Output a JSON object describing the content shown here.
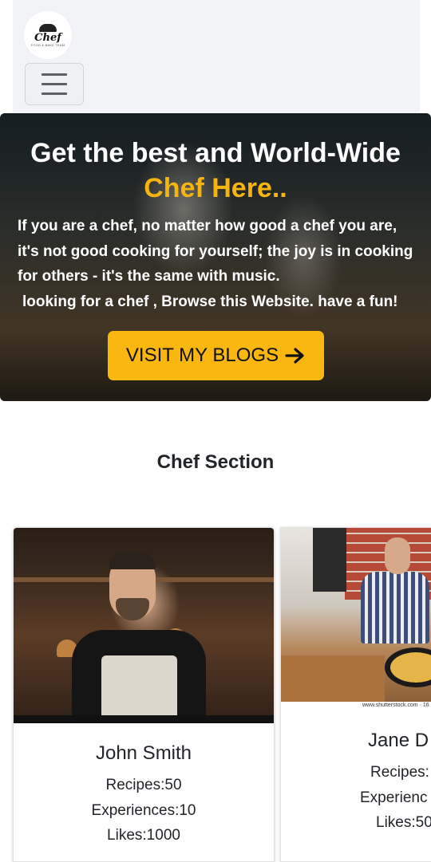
{
  "navbar": {
    "logo_text": "Chef",
    "logo_tagline": "FOOD & BAKE TEAM",
    "menu_button": "hamburger-icon"
  },
  "hero": {
    "title": "Get the best and World-Wide",
    "title_accent": "Chef Here..",
    "text_line1": "If you are a chef, no matter how good a chef you are, it's not good cooking for yourself; the joy is in cooking for others - it's the same with music.",
    "text_line2": "looking for a chef , Browse this Website. have a fun!",
    "button_label": "VISIT MY BLOGS",
    "button_icon": "arrow-right-icon",
    "accent_color": "#f9b710"
  },
  "chef_section": {
    "title": "Chef Section",
    "chefs": [
      {
        "name": "John Smith",
        "recipes": "Recipes:50",
        "experiences": "Experiences:10",
        "likes": "Likes:1000"
      },
      {
        "name": "Jane D",
        "recipes": "Recipes:",
        "experiences": "Experienc",
        "likes": "Likes:50",
        "watermark": "www.shutterstock.com · 16"
      }
    ]
  }
}
